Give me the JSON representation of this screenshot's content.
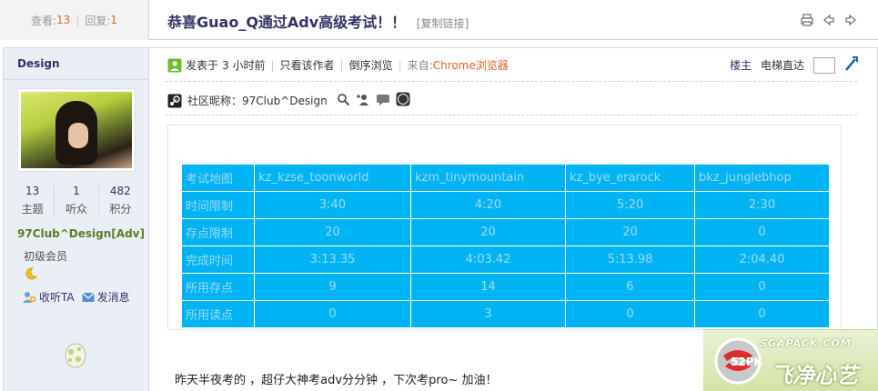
{
  "header": {
    "views_label": "查看:",
    "views_count": "13",
    "replies_label": "回复:",
    "replies_count": "1",
    "title": "恭喜Guao_Q通过Adv高级考试！！",
    "copy_link": "[复制链接]"
  },
  "user": {
    "name": "Design",
    "stats": [
      {
        "value": "13",
        "label": "主题"
      },
      {
        "value": "1",
        "label": "听众"
      },
      {
        "value": "482",
        "label": "积分"
      }
    ],
    "full_name": "97Club^Design[Adv]",
    "level": "初级会员",
    "follow_label": "收听TA",
    "message_label": "发消息"
  },
  "post": {
    "posted_prefix": "发表于",
    "posted_time": "3 小时前",
    "only_author": "只看该作者",
    "reverse_browse": "倒序浏览",
    "from_label": "来自:",
    "browser": "Chrome浏览器",
    "floor": "楼主",
    "jump_label": "电梯直达",
    "nickname_label": "社区昵称：",
    "nickname": "97Club^Design",
    "text": "昨天半夜考的 ，超仔大神考adv分分钟 ，下次考pro~ 加油！"
  },
  "table": {
    "header": [
      "考试地图",
      "kz_kzse_toonworld",
      "kzm_tinymountain",
      "kz_bye_erarock",
      "bkz_junglebhop"
    ],
    "rows": [
      [
        "时间限制",
        "3:40",
        "4:20",
        "5:20",
        "2:30"
      ],
      [
        "存点限制",
        "20",
        "20",
        "20",
        "0"
      ],
      [
        "完成时间",
        "3:13.35",
        "4:03.42",
        "5:13.98",
        "2:04.40"
      ],
      [
        "所用存点",
        "9",
        "14",
        "6",
        "0"
      ],
      [
        "所用读点",
        "0",
        "3",
        "0",
        "0"
      ]
    ]
  },
  "watermark": {
    "site": "52PK",
    "domain": "SGAPACK.COM",
    "brand": "飞净心艺"
  }
}
